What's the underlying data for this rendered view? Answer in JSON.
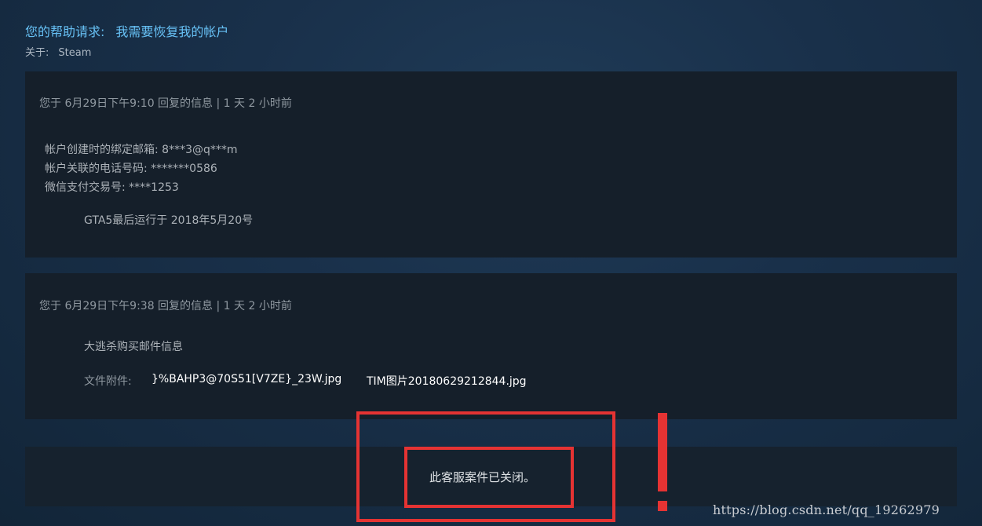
{
  "header": {
    "title_prefix": "您的帮助请求:",
    "title_subject": "我需要恢复我的帐户",
    "about_label": "关于:",
    "about_value": "Steam"
  },
  "messages": [
    {
      "meta": "您于 6月29日下午9:10 回复的信息 | 1 天 2 小时前",
      "lines": [
        "帐户创建时的绑定邮箱: 8***3@q***m",
        "帐户关联的电话号码: *******0586",
        "微信支付交易号: ****1253",
        "GTA5最后运行于 2018年5月20号"
      ]
    },
    {
      "meta": "您于 6月29日下午9:38 回复的信息 | 1 天 2 小时前",
      "lines": [
        "大逃杀购买邮件信息"
      ],
      "attachments_label": "文件附件:",
      "attachments": [
        "}%BAHP3@70S51[V7ZE}_23W.jpg",
        "TIM图片20180629212844.jpg"
      ]
    }
  ],
  "closed_notice": "此客服案件已关闭。",
  "watermark": "https://blog.csdn.net/qq_19262979",
  "colors": {
    "link": "#67c1f5",
    "panel": "#151f2a",
    "annotation_red": "#e53333"
  }
}
